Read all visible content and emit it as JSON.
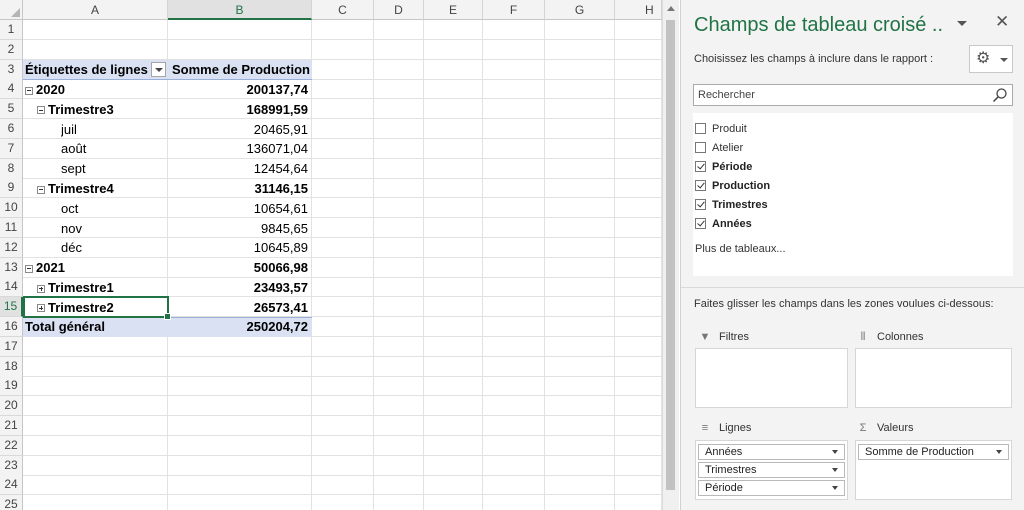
{
  "columns": [
    "A",
    "B",
    "C",
    "D",
    "E",
    "F",
    "G",
    "H"
  ],
  "rows": [
    "1",
    "2",
    "3",
    "4",
    "5",
    "6",
    "7",
    "8",
    "9",
    "10",
    "11",
    "12",
    "13",
    "14",
    "15",
    "16",
    "17",
    "18",
    "19",
    "20",
    "21",
    "22",
    "23",
    "24",
    "25"
  ],
  "pivot": {
    "header_label": "Étiquettes de lignes",
    "header_value": "Somme de Production",
    "lines": [
      {
        "label": "2020",
        "value": "200137,74",
        "bold": true,
        "indent": 0,
        "toggle": "minus"
      },
      {
        "label": "Trimestre3",
        "value": "168991,59",
        "bold": true,
        "indent": 1,
        "toggle": "minus"
      },
      {
        "label": "juil",
        "value": "20465,91",
        "bold": false,
        "indent": 2,
        "toggle": ""
      },
      {
        "label": "août",
        "value": "136071,04",
        "bold": false,
        "indent": 2,
        "toggle": ""
      },
      {
        "label": "sept",
        "value": "12454,64",
        "bold": false,
        "indent": 2,
        "toggle": ""
      },
      {
        "label": "Trimestre4",
        "value": "31146,15",
        "bold": true,
        "indent": 1,
        "toggle": "minus"
      },
      {
        "label": "oct",
        "value": "10654,61",
        "bold": false,
        "indent": 2,
        "toggle": ""
      },
      {
        "label": "nov",
        "value": "9845,65",
        "bold": false,
        "indent": 2,
        "toggle": ""
      },
      {
        "label": "déc",
        "value": "10645,89",
        "bold": false,
        "indent": 2,
        "toggle": ""
      },
      {
        "label": "2021",
        "value": "50066,98",
        "bold": true,
        "indent": 0,
        "toggle": "minus"
      },
      {
        "label": "Trimestre1",
        "value": "23493,57",
        "bold": true,
        "indent": 1,
        "toggle": "plus"
      },
      {
        "label": "Trimestre2",
        "value": "26573,41",
        "bold": true,
        "indent": 1,
        "toggle": "plus"
      }
    ],
    "total_label": "Total général",
    "total_value": "250204,72"
  },
  "pane": {
    "title": "Champs de tableau croisé ..",
    "close_glyph": "✕",
    "subtitle": "Choisissez les champs à inclure dans le rapport :",
    "search_placeholder": "Rechercher",
    "fields": [
      {
        "label": "Produit",
        "checked": false
      },
      {
        "label": "Atelier",
        "checked": false
      },
      {
        "label": "Période",
        "checked": true
      },
      {
        "label": "Production",
        "checked": true
      },
      {
        "label": "Trimestres",
        "checked": true
      },
      {
        "label": "Années",
        "checked": true
      }
    ],
    "more_tables": "Plus de tableaux...",
    "hint": "Faites glisser les champs dans les zones voulues ci-dessous:",
    "areas": {
      "filters": {
        "title": "Filtres",
        "icon": "filter-icon"
      },
      "columns": {
        "title": "Colonnes",
        "icon": "columns-icon"
      },
      "rows": {
        "title": "Lignes",
        "icon": "rows-icon",
        "items": [
          "Années",
          "Trimestres",
          "Période"
        ]
      },
      "values": {
        "title": "Valeurs",
        "icon": "sigma-icon",
        "items": [
          "Somme de Production"
        ]
      }
    }
  },
  "colors": {
    "accent": "#217346",
    "pivot_header": "#d9e1f2"
  }
}
